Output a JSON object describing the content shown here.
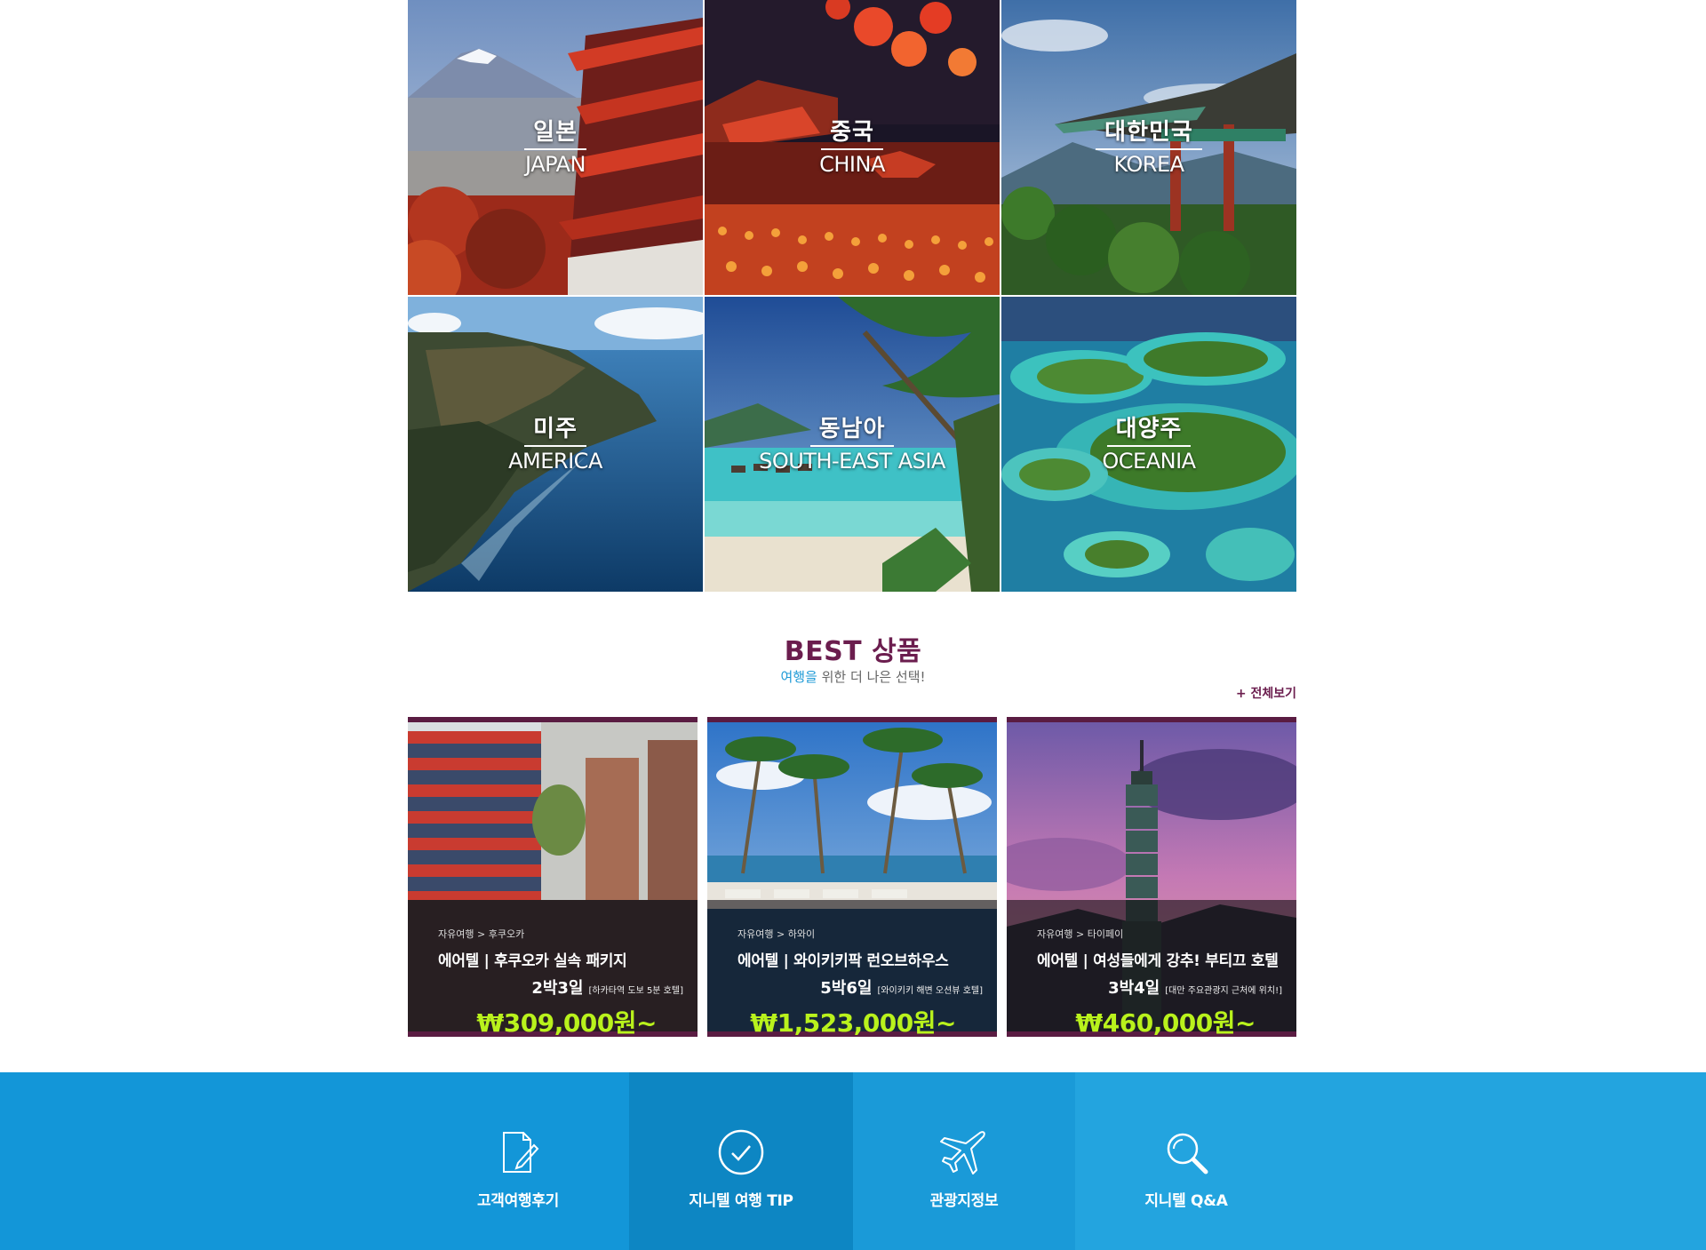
{
  "destinations": [
    {
      "ko": "일본",
      "en": "JAPAN"
    },
    {
      "ko": "중국",
      "en": "CHINA"
    },
    {
      "ko": "대한민국",
      "en": "KOREA"
    },
    {
      "ko": "미주",
      "en": "AMERICA"
    },
    {
      "ko": "동남아",
      "en": "SOUTH-EAST ASIA"
    },
    {
      "ko": "대양주",
      "en": "OCEANIA"
    }
  ],
  "best": {
    "title": "BEST 상품",
    "subtitle_highlight": "여행을",
    "subtitle_rest": " 위한 더 나은 선택!",
    "view_all": "+ 전체보기",
    "products": [
      {
        "crumb_type": "자유여행",
        "crumb_place": "후쿠오카",
        "name": "에어텔 | 후쿠오카 실속 패키지",
        "nights": "2박3일",
        "note": "[하카타역 도보 5분 호텔]",
        "price": "₩309,000원~"
      },
      {
        "crumb_type": "자유여행",
        "crumb_place": "하와이",
        "name": "에어텔 | 와이키키팍 런오브하우스",
        "nights": "5박6일",
        "note": "[와이키키 해변 오션뷰 호텔]",
        "price": "₩1,523,000원~"
      },
      {
        "crumb_type": "자유여행",
        "crumb_place": "타이페이",
        "name": "에어텔 | 여성들에게 강추! 부티끄 호텔",
        "nights": "3박4일",
        "note": "[대만 주요관광지 근처에 위치!]",
        "price": "₩460,000원~"
      }
    ]
  },
  "footer": {
    "items": [
      {
        "label": "고객여행후기",
        "icon": "pencil-note-icon"
      },
      {
        "label": "지니텔 여행 TIP",
        "icon": "check-circle-icon"
      },
      {
        "label": "관광지정보",
        "icon": "airplane-icon"
      },
      {
        "label": "지니텔 Q&A",
        "icon": "search-icon"
      }
    ]
  }
}
